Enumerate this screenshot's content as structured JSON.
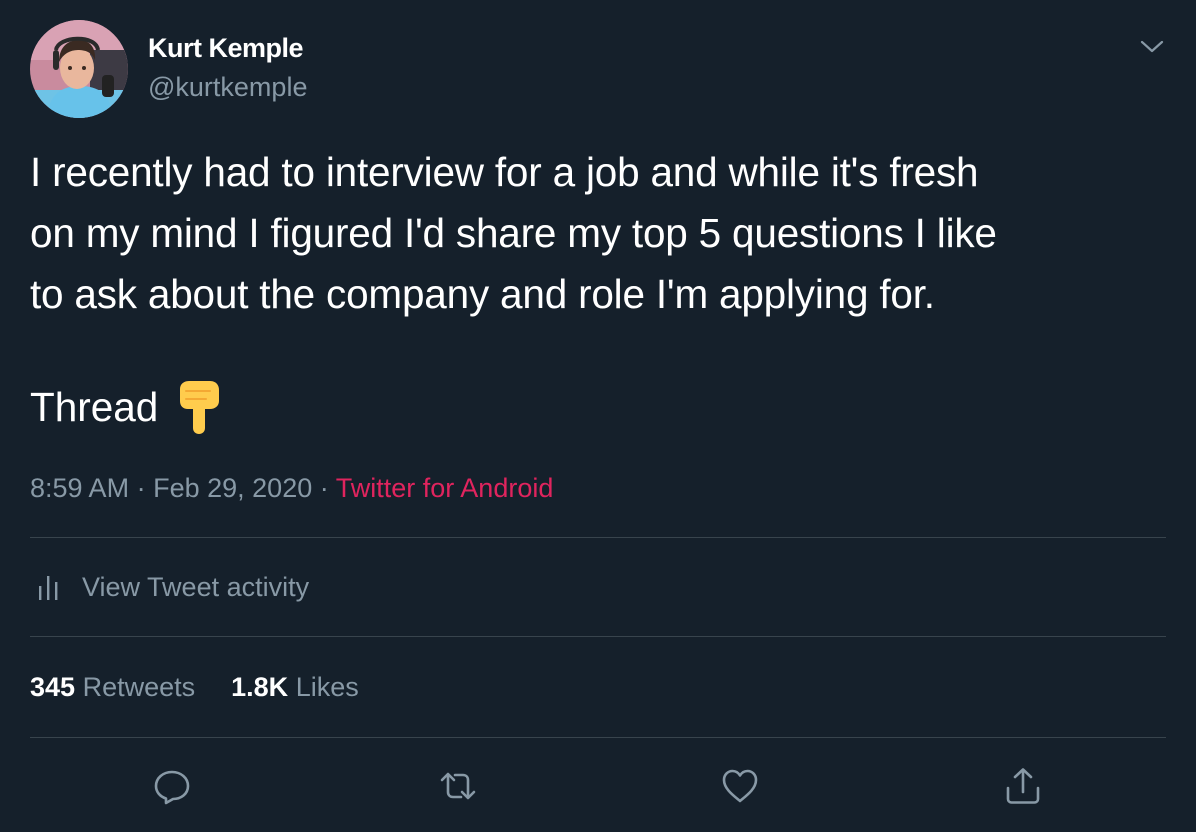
{
  "user": {
    "name": "Kurt Kemple",
    "handle": "@kurtkemple",
    "avatar_icon": "profile-photo"
  },
  "tweet": {
    "text": "I recently had to interview for a job and while it's fresh\non my mind I figured I'd share my top 5 questions I like\nto ask about the company and role I'm applying for.",
    "thread_label": "Thread",
    "thread_emoji": "backhand-index-pointing-down",
    "time": "8:59 AM",
    "separator": "·",
    "date": "Feb 29, 2020",
    "source": "Twitter for Android"
  },
  "activity": {
    "label": "View Tweet activity",
    "icon": "bar-chart-icon"
  },
  "stats": {
    "retweets_count": "345",
    "retweets_label": "Retweets",
    "likes_count": "1.8K",
    "likes_label": "Likes"
  },
  "actions": [
    "reply-icon",
    "retweet-icon",
    "like-icon",
    "share-icon"
  ],
  "colors": {
    "background": "#15202b",
    "text_primary": "#ffffff",
    "text_secondary": "#8899a6",
    "source_link": "#e0245e",
    "divider": "#38444d"
  }
}
